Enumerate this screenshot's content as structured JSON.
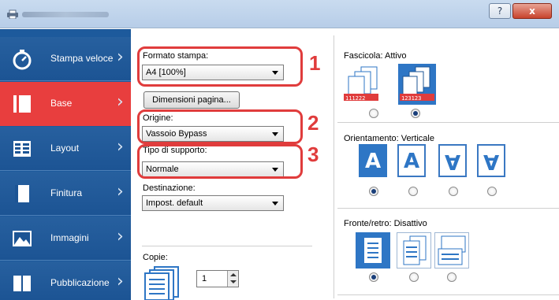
{
  "window": {
    "help_label": "?",
    "close_label": "x"
  },
  "sidebar": {
    "items": [
      {
        "label": "Stampa veloce",
        "icon": "stopwatch-icon"
      },
      {
        "label": "Base",
        "icon": "page-icon",
        "active": true
      },
      {
        "label": "Layout",
        "icon": "layout-icon"
      },
      {
        "label": "Finitura",
        "icon": "finishing-icon"
      },
      {
        "label": "Immagini",
        "icon": "image-icon"
      },
      {
        "label": "Pubblicazione",
        "icon": "publication-icon"
      }
    ]
  },
  "settings": {
    "paper_size_label": "Formato stampa:",
    "paper_size_value": "A4  [100%]",
    "page_size_button": "Dimensioni pagina...",
    "source_label": "Origine:",
    "source_value": "Vassoio Bypass",
    "media_type_label": "Tipo di supporto:",
    "media_type_value": "Normale",
    "destination_label": "Destinazione:",
    "destination_value": "Impost. default",
    "copies_label": "Copie:",
    "copies_value": "1"
  },
  "callouts": [
    "1",
    "2",
    "3"
  ],
  "collate": {
    "label": "Fascicola:",
    "value": "Attivo",
    "option_off_text": "111222",
    "option_on_text": "123123"
  },
  "orientation": {
    "label": "Orientamento:",
    "value": "Verticale",
    "glyph": "A"
  },
  "duplex": {
    "label": "Fronte/retro:",
    "value": "Disattivo"
  },
  "colors": {
    "sidebar": "#1d5a9c",
    "active": "#e83e3e",
    "callout": "#e03c3c",
    "selection": "#2e76c5"
  }
}
